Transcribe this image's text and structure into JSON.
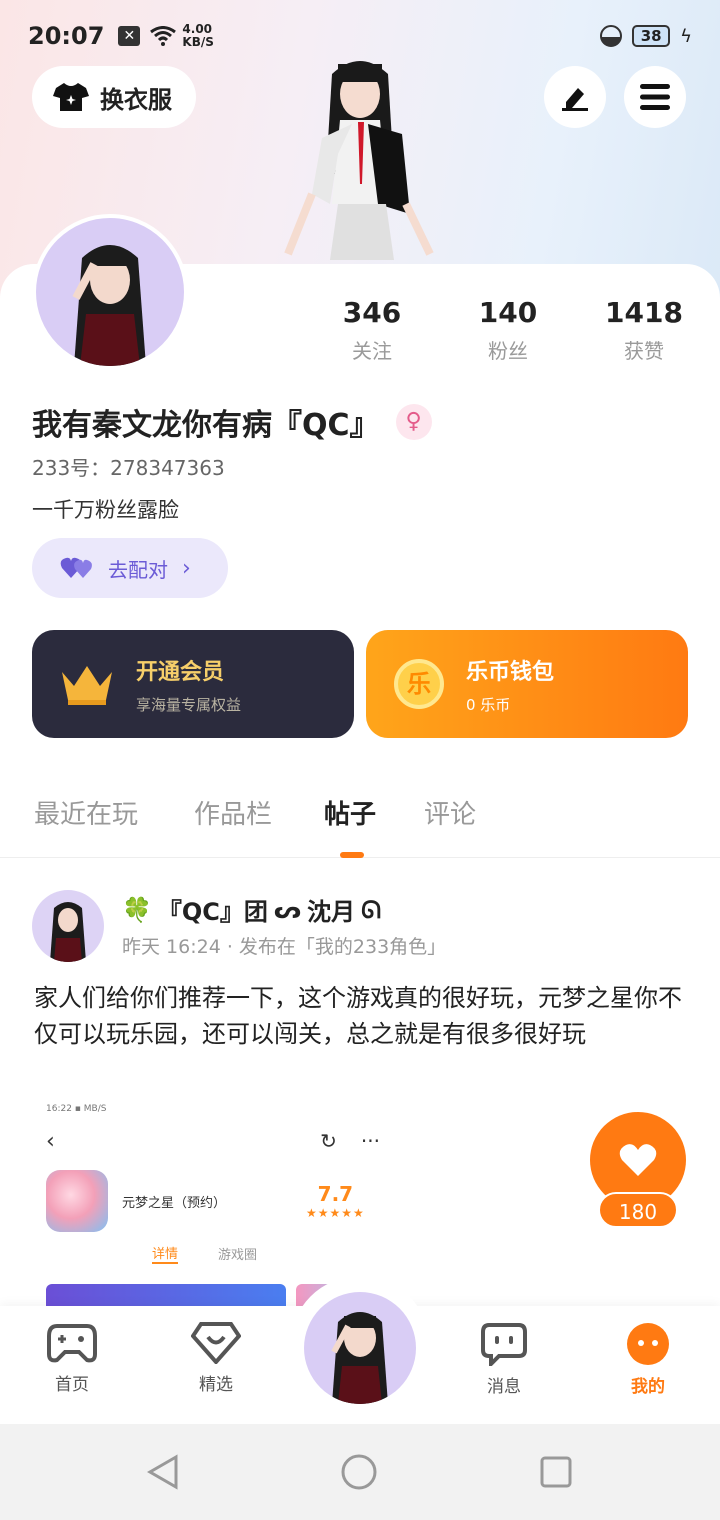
{
  "status_bar": {
    "time": "20:07",
    "net_speed_value": "4.00",
    "net_speed_unit": "KB/S",
    "battery": "38"
  },
  "header": {
    "outfit_label": "换衣服"
  },
  "profile": {
    "stats": [
      {
        "value": "346",
        "label": "关注"
      },
      {
        "value": "140",
        "label": "粉丝"
      },
      {
        "value": "1418",
        "label": "获赞"
      }
    ],
    "username": "我有秦文龙你有病『QC』",
    "user_id": "233号：278347363",
    "bio": "一千万粉丝露脸",
    "match_label": "去配对"
  },
  "promos": {
    "vip": {
      "title": "开通会员",
      "subtitle": "享海量专属权益"
    },
    "wallet": {
      "title": "乐币钱包",
      "subtitle": "0 乐币",
      "coin_glyph": "乐"
    }
  },
  "tabs": [
    "最近在玩",
    "作品栏",
    "帖子",
    "评论"
  ],
  "post": {
    "author": "『QC』团",
    "author_suffix": "沈月",
    "meta": "昨天 16:24 · 发布在「我的233角色」",
    "text": "家人们给你们推荐一下，这个游戏真的很好玩，元梦之星你不仅可以玩乐园，还可以闯关，总之就是有很多很好玩",
    "like_count": "180",
    "screenshot": {
      "status": "16:22 ▪ MB/S",
      "app_name": "元梦之星（预约）",
      "score": "7.7",
      "stars": "★★★★★",
      "tab_details": "详情",
      "tab_circle": "游戏圈"
    }
  },
  "bottom_nav": [
    {
      "label": "首页"
    },
    {
      "label": "精选"
    },
    {
      "label": "消息"
    },
    {
      "label": "我的"
    }
  ]
}
